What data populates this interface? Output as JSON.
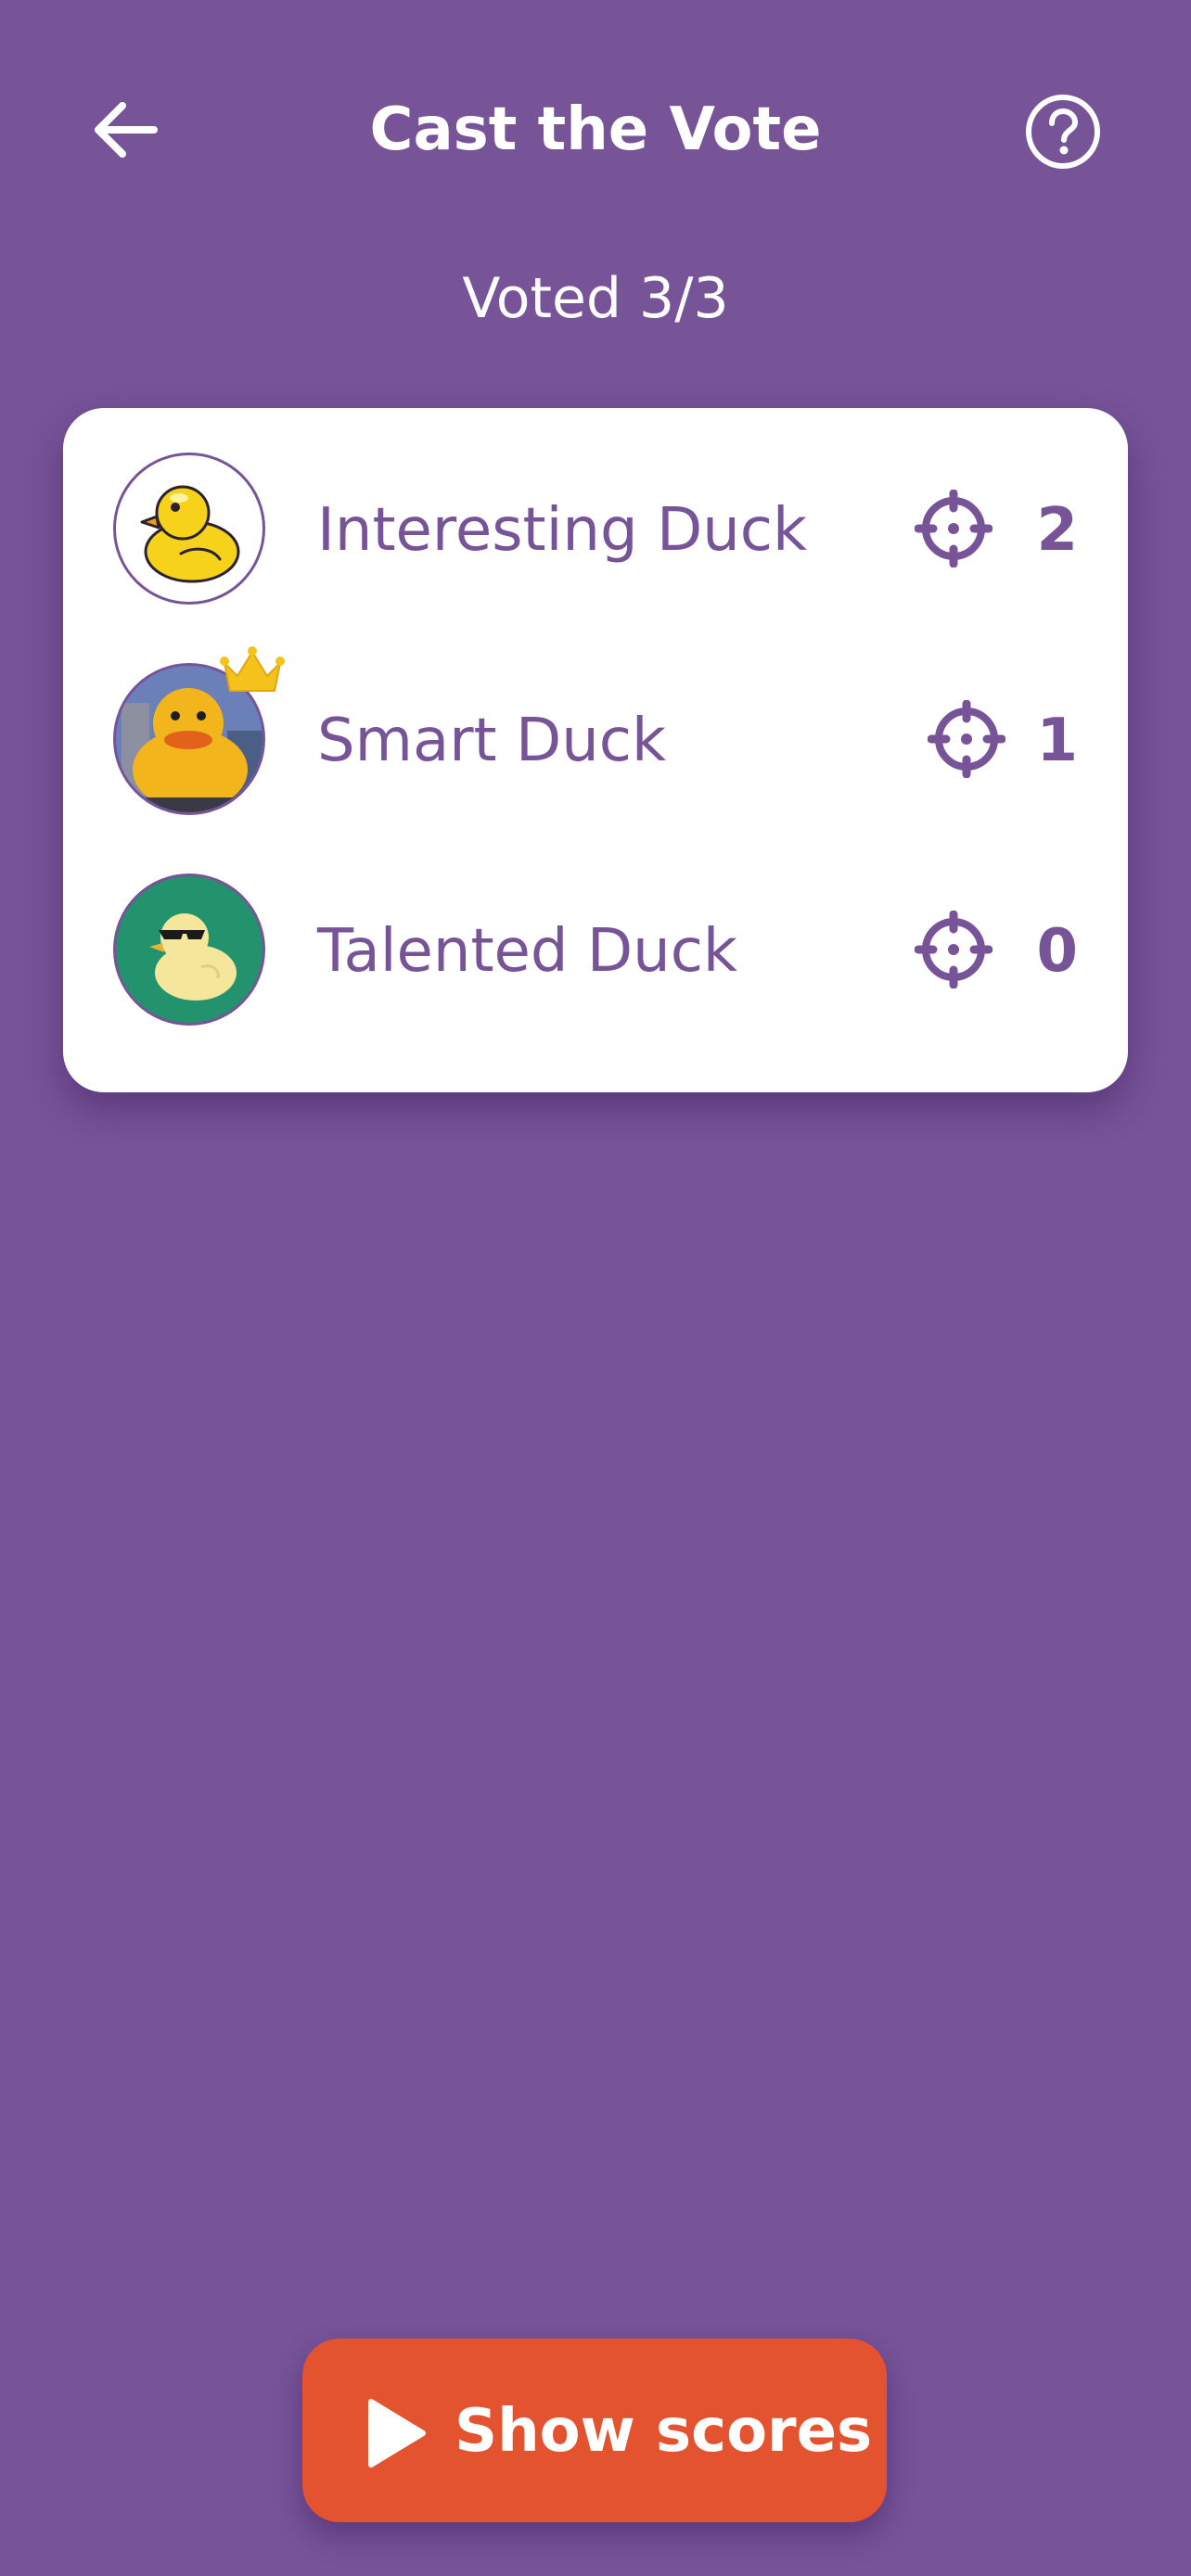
{
  "header": {
    "title": "Cast the Vote",
    "back_icon": "arrow-left-icon",
    "help_icon": "question-circle-icon"
  },
  "status": {
    "voted_text": "Voted 3/3"
  },
  "players": [
    {
      "name": "Interesting Duck",
      "votes": "2",
      "avatar": "rubber-duck-avatar",
      "leader": false
    },
    {
      "name": "Smart Duck",
      "votes": "1",
      "avatar": "giant-duck-photo-avatar",
      "leader": true
    },
    {
      "name": "Talented Duck",
      "votes": "0",
      "avatar": "sunglasses-duck-avatar",
      "leader": false
    }
  ],
  "actions": {
    "show_scores_label": "Show scores",
    "show_scores_icon": "play-icon"
  },
  "colors": {
    "background": "#775398",
    "accent_text": "#775398",
    "button": "#e4532f",
    "card": "#ffffff",
    "crown": "#f4c21b"
  }
}
